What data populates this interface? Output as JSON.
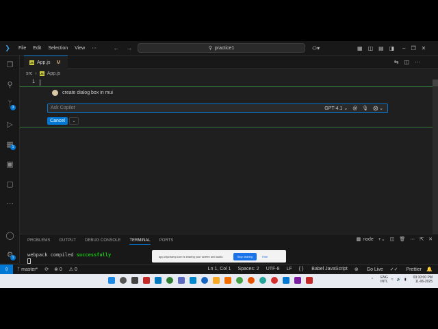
{
  "menu": [
    "File",
    "Edit",
    "Selection",
    "View",
    "⋯"
  ],
  "search": {
    "text": "practice1"
  },
  "tab": {
    "filename": "App.js",
    "status": "M"
  },
  "breadcrumb": {
    "folder": "src",
    "file": "App.js"
  },
  "editor": {
    "line_number": "1"
  },
  "copilot": {
    "prompt": "create dialog box in mui",
    "placeholder": "Ask Copilot",
    "model": "GPT-4.1",
    "cancel_label": "Cancel"
  },
  "activity_badges": {
    "source_control": "3",
    "extensions": "1",
    "settings": "1"
  },
  "panel": {
    "tabs": [
      "PROBLEMS",
      "OUTPUT",
      "DEBUG CONSOLE",
      "TERMINAL",
      "PORTS"
    ],
    "active_tab": "TERMINAL",
    "terminal_name": "node",
    "terminal_text": "webpack compiled ",
    "terminal_success": "successfully"
  },
  "share_toast": {
    "message": "app.clipchamp.com is sharing your screen and audio.",
    "stop_label": "Stop sharing",
    "hide_label": "Hide"
  },
  "status": {
    "branch": "master*",
    "errors": "0",
    "warnings": "0",
    "position": "Ln 1, Col 1",
    "spaces": "Spaces: 2",
    "encoding": "UTF-8",
    "eol": "LF",
    "language": "Babel JavaScript",
    "golive": "Go Live",
    "prettier": "Prettier"
  },
  "taskbar": {
    "lang": "ENG",
    "region": "INTL",
    "time": "03:10:00 PM",
    "date": "11-06-2025"
  },
  "colors": {
    "accent": "#0078d4",
    "editor_bg": "#1f1f1f",
    "success": "#16c60c"
  }
}
